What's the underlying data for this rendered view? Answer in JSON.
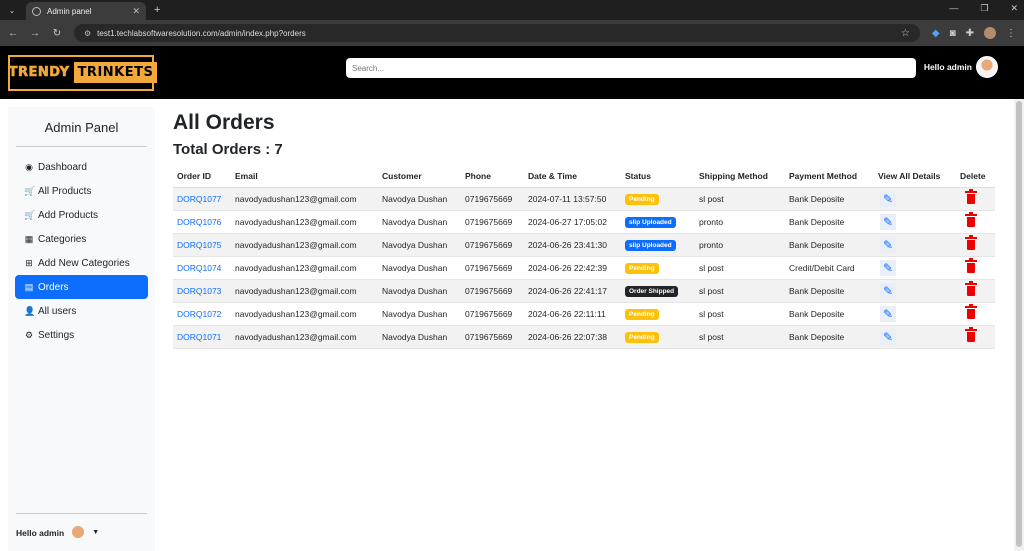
{
  "browser": {
    "tab_title": "Admin panel",
    "url_text": "test1.techlabsoftwaresolution.com/admin/index.php?orders"
  },
  "header": {
    "logo_left": "TRENDY",
    "logo_right": "TRINKETS",
    "search_placeholder": "Search...",
    "greeting": "Hello admin"
  },
  "sidebar": {
    "title": "Admin Panel",
    "items": [
      {
        "label": "Dashboard",
        "icon": "tachometer-icon",
        "glyph": "◉"
      },
      {
        "label": "All Products",
        "icon": "cart-icon",
        "glyph": "🛒"
      },
      {
        "label": "Add Products",
        "icon": "cart-plus-icon",
        "glyph": "🛒"
      },
      {
        "label": "Categories",
        "icon": "table-icon",
        "glyph": "▦"
      },
      {
        "label": "Add New Categories",
        "icon": "plus-square-icon",
        "glyph": "⊞"
      },
      {
        "label": "Orders",
        "icon": "receipt-icon",
        "glyph": "▤"
      },
      {
        "label": "All users",
        "icon": "user-icon",
        "glyph": "👤"
      },
      {
        "label": "Settings",
        "icon": "gear-icon",
        "glyph": "⚙"
      }
    ],
    "footer_greeting": "Hello admin"
  },
  "main": {
    "title": "All Orders",
    "total_label": "Total Orders : 7",
    "columns": [
      "Order ID",
      "Email",
      "Customer",
      "Phone",
      "Date & Time",
      "Status",
      "Shipping Method",
      "Payment Method",
      "View All Details",
      "Delete"
    ],
    "rows": [
      {
        "id": "DORQ1077",
        "email": "navodyadushan123@gmail.com",
        "customer": "Navodya Dushan",
        "phone": "0719675669",
        "datetime": "2024-07-11 13:57:50",
        "status": "Pending",
        "status_type": "pending",
        "shipping": "sl post",
        "payment": "Bank Deposite"
      },
      {
        "id": "DORQ1076",
        "email": "navodyadushan123@gmail.com",
        "customer": "Navodya Dushan",
        "phone": "0719675669",
        "datetime": "2024-06-27 17:05:02",
        "status": "slip Uploaded",
        "status_type": "slip",
        "shipping": "pronto",
        "payment": "Bank Deposite"
      },
      {
        "id": "DORQ1075",
        "email": "navodyadushan123@gmail.com",
        "customer": "Navodya Dushan",
        "phone": "0719675669",
        "datetime": "2024-06-26 23:41:30",
        "status": "slip Uploaded",
        "status_type": "slip",
        "shipping": "pronto",
        "payment": "Bank Deposite"
      },
      {
        "id": "DORQ1074",
        "email": "navodyadushan123@gmail.com",
        "customer": "Navodya Dushan",
        "phone": "0719675669",
        "datetime": "2024-06-26 22:42:39",
        "status": "Pending",
        "status_type": "pending",
        "shipping": "sl post",
        "payment": "Credit/Debit Card"
      },
      {
        "id": "DORQ1073",
        "email": "navodyadushan123@gmail.com",
        "customer": "Navodya Dushan",
        "phone": "0719675669",
        "datetime": "2024-06-26 22:41:17",
        "status": "Order Shipped",
        "status_type": "ship",
        "shipping": "sl post",
        "payment": "Bank Deposite"
      },
      {
        "id": "DORQ1072",
        "email": "navodyadushan123@gmail.com",
        "customer": "Navodya Dushan",
        "phone": "0719675669",
        "datetime": "2024-06-26 22:11:11",
        "status": "Pending",
        "status_type": "pending",
        "shipping": "sl post",
        "payment": "Bank Deposite"
      },
      {
        "id": "DORQ1071",
        "email": "navodyadushan123@gmail.com",
        "customer": "Navodya Dushan",
        "phone": "0719675669",
        "datetime": "2024-06-26 22:07:38",
        "status": "Pending",
        "status_type": "pending",
        "shipping": "sl post",
        "payment": "Bank Deposite"
      }
    ]
  },
  "colors": {
    "accent": "#0d6efd",
    "logo": "#f2a93b",
    "pending": "#ffc107",
    "delete": "#dc0000"
  }
}
